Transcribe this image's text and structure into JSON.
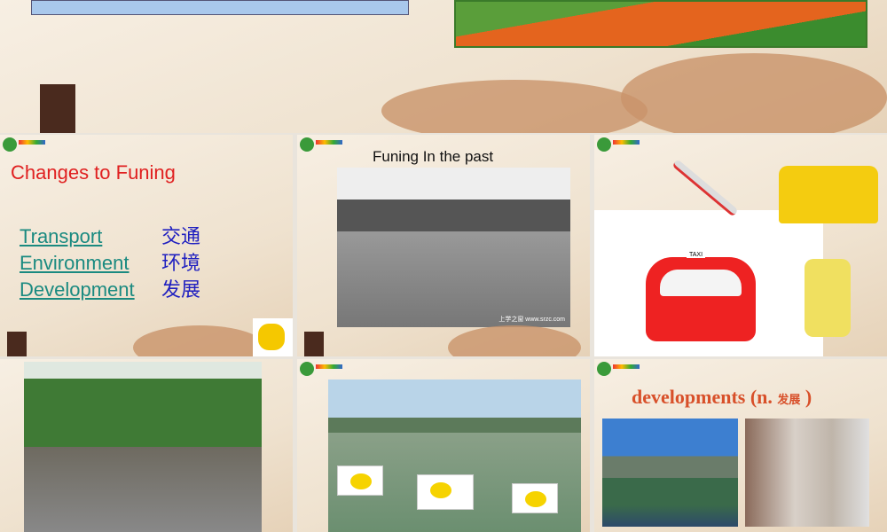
{
  "slides": [
    {
      "id": "top-partial"
    },
    {
      "id": "slide-1",
      "title": "Changes to Funing",
      "vocab": [
        {
          "en": "Transport ",
          "zh": "交通"
        },
        {
          "en": "Environment",
          "zh": "环境"
        },
        {
          "en": "Development",
          "zh": "发展"
        }
      ]
    },
    {
      "id": "slide-2",
      "title": "Funing In the past",
      "watermark": "上学之窗 www.srzc.com"
    },
    {
      "id": "slide-3",
      "taxi_sign": "TAXI"
    },
    {
      "id": "slide-4"
    },
    {
      "id": "slide-5"
    },
    {
      "id": "slide-6",
      "title": "developments (n. ",
      "title_zh": "发展",
      "title_end": " )"
    }
  ],
  "colors": {
    "red_title": "#e02020",
    "link": "#1a8a80",
    "zh": "#2020c0",
    "orange": "#d8502a"
  }
}
